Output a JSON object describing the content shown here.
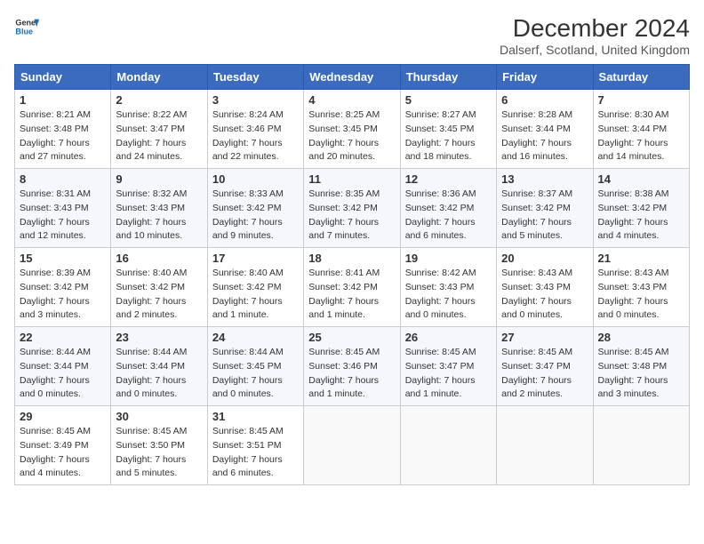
{
  "header": {
    "logo_line1": "General",
    "logo_line2": "Blue",
    "month_title": "December 2024",
    "subtitle": "Dalserf, Scotland, United Kingdom"
  },
  "weekdays": [
    "Sunday",
    "Monday",
    "Tuesday",
    "Wednesday",
    "Thursday",
    "Friday",
    "Saturday"
  ],
  "weeks": [
    [
      {
        "day": "1",
        "sunrise": "8:21 AM",
        "sunset": "3:48 PM",
        "daylight": "7 hours and 27 minutes."
      },
      {
        "day": "2",
        "sunrise": "8:22 AM",
        "sunset": "3:47 PM",
        "daylight": "7 hours and 24 minutes."
      },
      {
        "day": "3",
        "sunrise": "8:24 AM",
        "sunset": "3:46 PM",
        "daylight": "7 hours and 22 minutes."
      },
      {
        "day": "4",
        "sunrise": "8:25 AM",
        "sunset": "3:45 PM",
        "daylight": "7 hours and 20 minutes."
      },
      {
        "day": "5",
        "sunrise": "8:27 AM",
        "sunset": "3:45 PM",
        "daylight": "7 hours and 18 minutes."
      },
      {
        "day": "6",
        "sunrise": "8:28 AM",
        "sunset": "3:44 PM",
        "daylight": "7 hours and 16 minutes."
      },
      {
        "day": "7",
        "sunrise": "8:30 AM",
        "sunset": "3:44 PM",
        "daylight": "7 hours and 14 minutes."
      }
    ],
    [
      {
        "day": "8",
        "sunrise": "8:31 AM",
        "sunset": "3:43 PM",
        "daylight": "7 hours and 12 minutes."
      },
      {
        "day": "9",
        "sunrise": "8:32 AM",
        "sunset": "3:43 PM",
        "daylight": "7 hours and 10 minutes."
      },
      {
        "day": "10",
        "sunrise": "8:33 AM",
        "sunset": "3:42 PM",
        "daylight": "7 hours and 9 minutes."
      },
      {
        "day": "11",
        "sunrise": "8:35 AM",
        "sunset": "3:42 PM",
        "daylight": "7 hours and 7 minutes."
      },
      {
        "day": "12",
        "sunrise": "8:36 AM",
        "sunset": "3:42 PM",
        "daylight": "7 hours and 6 minutes."
      },
      {
        "day": "13",
        "sunrise": "8:37 AM",
        "sunset": "3:42 PM",
        "daylight": "7 hours and 5 minutes."
      },
      {
        "day": "14",
        "sunrise": "8:38 AM",
        "sunset": "3:42 PM",
        "daylight": "7 hours and 4 minutes."
      }
    ],
    [
      {
        "day": "15",
        "sunrise": "8:39 AM",
        "sunset": "3:42 PM",
        "daylight": "7 hours and 3 minutes."
      },
      {
        "day": "16",
        "sunrise": "8:40 AM",
        "sunset": "3:42 PM",
        "daylight": "7 hours and 2 minutes."
      },
      {
        "day": "17",
        "sunrise": "8:40 AM",
        "sunset": "3:42 PM",
        "daylight": "7 hours and 1 minute."
      },
      {
        "day": "18",
        "sunrise": "8:41 AM",
        "sunset": "3:42 PM",
        "daylight": "7 hours and 1 minute."
      },
      {
        "day": "19",
        "sunrise": "8:42 AM",
        "sunset": "3:43 PM",
        "daylight": "7 hours and 0 minutes."
      },
      {
        "day": "20",
        "sunrise": "8:43 AM",
        "sunset": "3:43 PM",
        "daylight": "7 hours and 0 minutes."
      },
      {
        "day": "21",
        "sunrise": "8:43 AM",
        "sunset": "3:43 PM",
        "daylight": "7 hours and 0 minutes."
      }
    ],
    [
      {
        "day": "22",
        "sunrise": "8:44 AM",
        "sunset": "3:44 PM",
        "daylight": "7 hours and 0 minutes."
      },
      {
        "day": "23",
        "sunrise": "8:44 AM",
        "sunset": "3:44 PM",
        "daylight": "7 hours and 0 minutes."
      },
      {
        "day": "24",
        "sunrise": "8:44 AM",
        "sunset": "3:45 PM",
        "daylight": "7 hours and 0 minutes."
      },
      {
        "day": "25",
        "sunrise": "8:45 AM",
        "sunset": "3:46 PM",
        "daylight": "7 hours and 1 minute."
      },
      {
        "day": "26",
        "sunrise": "8:45 AM",
        "sunset": "3:47 PM",
        "daylight": "7 hours and 1 minute."
      },
      {
        "day": "27",
        "sunrise": "8:45 AM",
        "sunset": "3:47 PM",
        "daylight": "7 hours and 2 minutes."
      },
      {
        "day": "28",
        "sunrise": "8:45 AM",
        "sunset": "3:48 PM",
        "daylight": "7 hours and 3 minutes."
      }
    ],
    [
      {
        "day": "29",
        "sunrise": "8:45 AM",
        "sunset": "3:49 PM",
        "daylight": "7 hours and 4 minutes."
      },
      {
        "day": "30",
        "sunrise": "8:45 AM",
        "sunset": "3:50 PM",
        "daylight": "7 hours and 5 minutes."
      },
      {
        "day": "31",
        "sunrise": "8:45 AM",
        "sunset": "3:51 PM",
        "daylight": "7 hours and 6 minutes."
      },
      null,
      null,
      null,
      null
    ]
  ]
}
